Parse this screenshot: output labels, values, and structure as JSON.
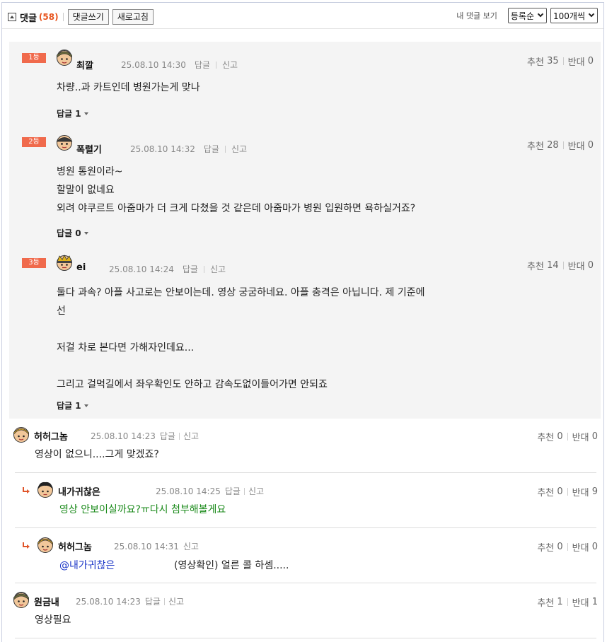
{
  "toolbar": {
    "title": "댓글",
    "count": "(58)",
    "write_label": "댓글쓰기",
    "refresh_label": "새로고침",
    "my_comments_label": "내 댓글 보기",
    "sort_selected": "등록순",
    "per_page_selected": "100개씩"
  },
  "common": {
    "reply_label": "답글",
    "report_label": "신고",
    "up_label": "추천",
    "down_label": "반대"
  },
  "best_comments": [
    {
      "rank": "1등",
      "nick": "최깔",
      "date": "25.08.10 14:30",
      "up": "35",
      "down": "0",
      "body": "차량..과 카트인데 병원가는게 맞나",
      "replies": "답글 1"
    },
    {
      "rank": "2등",
      "nick": "폭렬기",
      "date": "25.08.10 14:32",
      "up": "28",
      "down": "0",
      "body": "병원 통원이라~\n할말이 없네요\n외려 야쿠르트 아줌마가 더 크게 다쳤을 것 같은데 아줌마가 병원 입원하면 욕하실거죠?",
      "replies": "답글 0"
    },
    {
      "rank": "3등",
      "nick": "ei",
      "date": "25.08.10 14:24",
      "up": "14",
      "down": "0",
      "body": "둘다 과속? 아플 사고로는 안보이는데. 영상 궁굼하네요. 아플 충격은 아닙니다. 제 기준에\n선\n\n저걸 차로 본다면 가해자인데요...\n\n그리고 걸먹길에서 좌우확인도 안하고 감속도없이들어가면 안되죠",
      "replies": "답글 1"
    }
  ],
  "comments": [
    {
      "nick": "허허그놈",
      "date": "25.08.10 14:23",
      "up": "0",
      "down": "0",
      "body": "영상이 없으니....그게 맞겠죠?"
    },
    {
      "nick": "내가귀찮은",
      "date": "25.08.10 14:25",
      "up": "0",
      "down": "9",
      "body": "영상 안보이실까요?ㅠ다시 첨부해볼게요"
    },
    {
      "nick": "허허그놈",
      "date": "25.08.10 14:31",
      "up": "0",
      "down": "0",
      "mention": "@내가귀찮은",
      "body": "(영상확인) 얼른 콜 하셈....."
    },
    {
      "nick": "원금내",
      "date": "25.08.10 14:23",
      "up": "1",
      "down": "1",
      "body": "영상필요"
    }
  ],
  "colors": {
    "rank_badge": "#f06a4c",
    "count": "#e8551f",
    "author_reply_text": "#1a8a1a",
    "mention": "#1a35c7",
    "best_bg": "#f4f4f4"
  }
}
